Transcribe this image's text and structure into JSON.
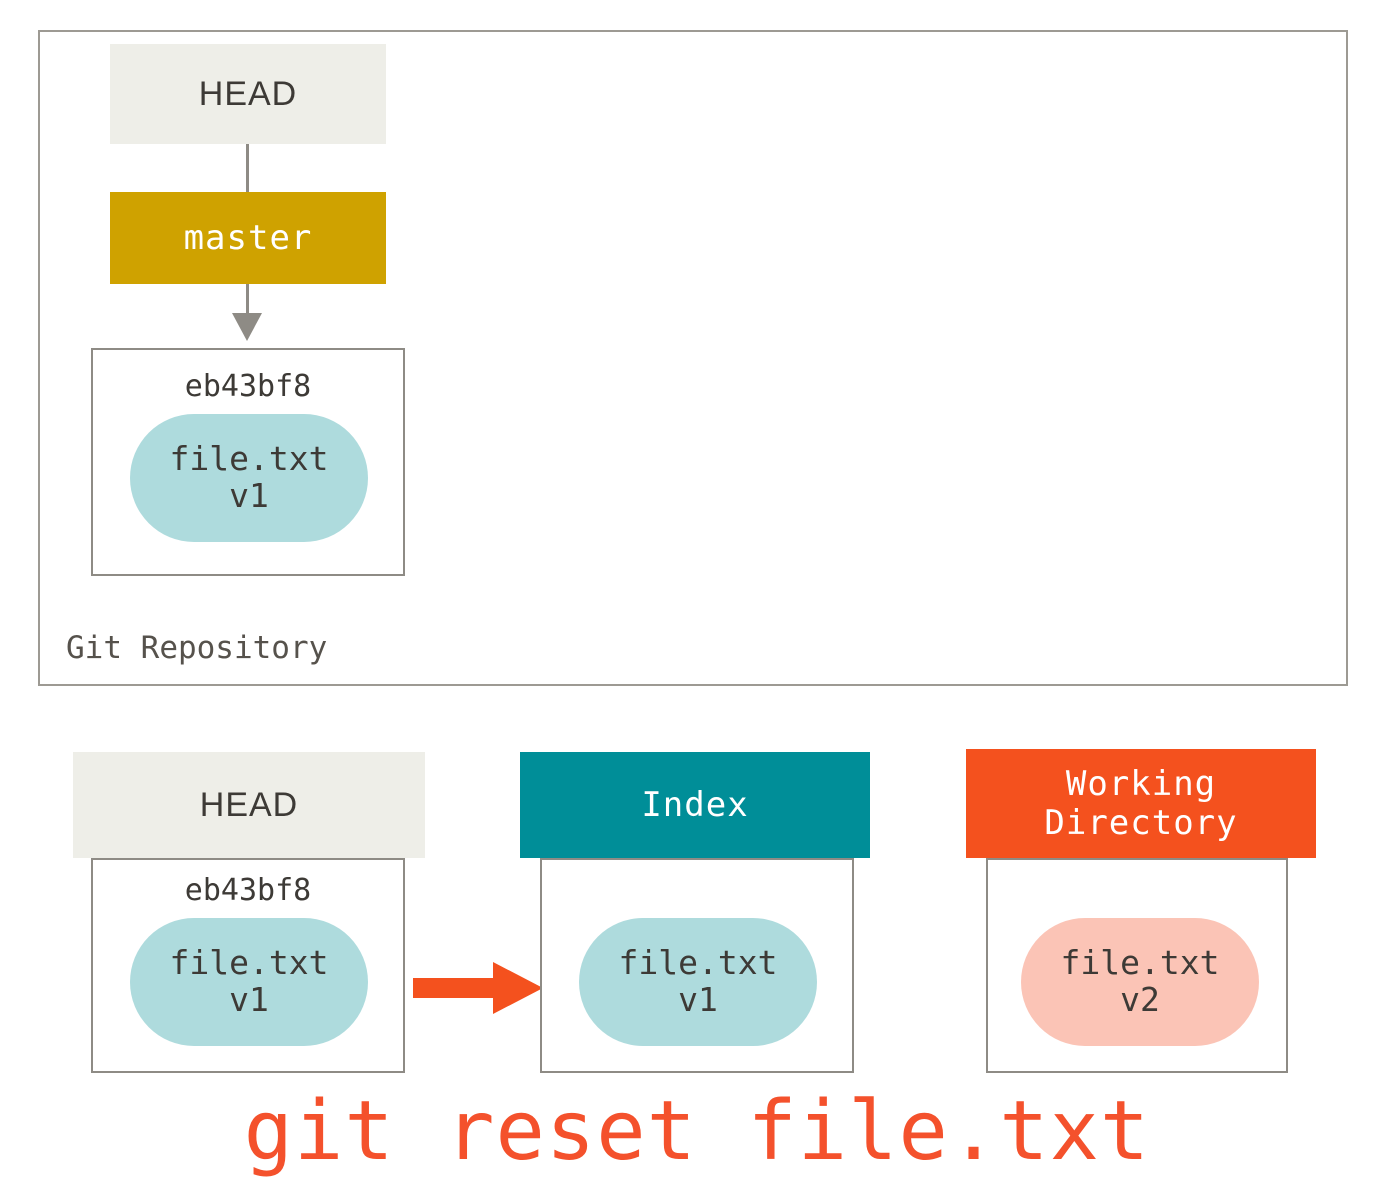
{
  "diagram": {
    "title_caption": "git reset file.txt",
    "repository": {
      "label": "Git Repository",
      "head_pointer": "HEAD",
      "branch": "master",
      "commit": {
        "sha": "eb43bf8",
        "blob_name": "file.txt",
        "blob_version": "v1"
      }
    },
    "areas": [
      {
        "key": "head",
        "header": "HEAD",
        "sha": "eb43bf8",
        "blob_name": "file.txt",
        "blob_version": "v1",
        "header_bg": "#eeeee8",
        "header_fg": "#3d3a36",
        "blob_color": "#aedbdd"
      },
      {
        "key": "index",
        "header": "Index",
        "sha": "",
        "blob_name": "file.txt",
        "blob_version": "v1",
        "header_bg": "#008e98",
        "header_fg": "#ffffff",
        "blob_color": "#aedbdd"
      },
      {
        "key": "working_directory",
        "header": "Working\nDirectory",
        "header_line1": "Working",
        "header_line2": "Directory",
        "sha": "",
        "blob_name": "file.txt",
        "blob_version": "v2",
        "header_bg": "#f4511e",
        "header_fg": "#ffffff",
        "blob_color": "#fbc4b6"
      }
    ],
    "arrow": {
      "from": "HEAD",
      "to": "Index",
      "color": "#f4511e"
    },
    "colors": {
      "frame_border": "#9d9a93",
      "box_border": "#8e8b85",
      "branch_bg": "#cfa200",
      "head_bg": "#eeeee8",
      "index_bg": "#008e98",
      "working_bg": "#f4511e",
      "blob_teal": "#aedbdd",
      "blob_pink": "#fbc4b6",
      "caption": "#f4512c",
      "text": "#3d3a36"
    }
  }
}
